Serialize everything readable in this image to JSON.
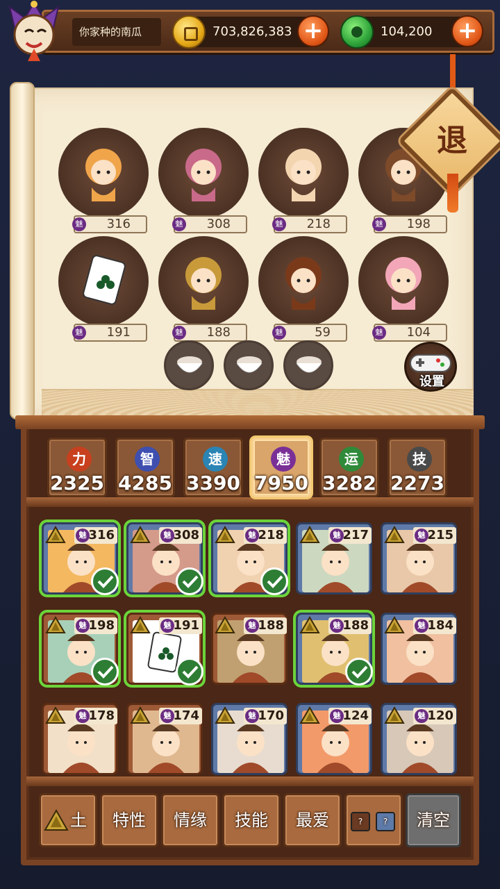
{
  "player": {
    "name": "你家种的南瓜",
    "gold": "703,826,383",
    "jade": "104,200"
  },
  "exit_label": "退",
  "settings_label": "设置",
  "top_heroes": [
    {
      "charm_badge": "魅",
      "charm": "316"
    },
    {
      "charm_badge": "魅",
      "charm": "308"
    },
    {
      "charm_badge": "魅",
      "charm": "218"
    },
    {
      "charm_badge": "魅",
      "charm": "198"
    },
    {
      "charm_badge": "魅",
      "charm": "191"
    },
    {
      "charm_badge": "魅",
      "charm": "188"
    },
    {
      "charm_badge": "魅",
      "charm": "59"
    },
    {
      "charm_badge": "魅",
      "charm": "104"
    }
  ],
  "stats": [
    {
      "label": "力",
      "value": "2325",
      "color": "#c8401e"
    },
    {
      "label": "智",
      "value": "4285",
      "color": "#3e4fb0"
    },
    {
      "label": "速",
      "value": "3390",
      "color": "#2a84b4"
    },
    {
      "label": "魅",
      "value": "7950",
      "color": "#7a2f96"
    },
    {
      "label": "运",
      "value": "3282",
      "color": "#2f8a3a"
    },
    {
      "label": "技",
      "value": "2273",
      "color": "#4a4a4a"
    }
  ],
  "cards": [
    {
      "charm": "316",
      "selected": true
    },
    {
      "charm": "308",
      "selected": true
    },
    {
      "charm": "218",
      "selected": true
    },
    {
      "charm": "217",
      "selected": false
    },
    {
      "charm": "215",
      "selected": false
    },
    {
      "charm": "198",
      "selected": true
    },
    {
      "charm": "191",
      "selected": true
    },
    {
      "charm": "188",
      "selected": false
    },
    {
      "charm": "188",
      "selected": true
    },
    {
      "charm": "184",
      "selected": false
    },
    {
      "charm": "178",
      "selected": false
    },
    {
      "charm": "174",
      "selected": false
    },
    {
      "charm": "170",
      "selected": false
    },
    {
      "charm": "124",
      "selected": false
    },
    {
      "charm": "120",
      "selected": false
    }
  ],
  "filters": {
    "element": "土",
    "trait": "特性",
    "fate": "情缘",
    "skill": "技能",
    "favorite": "最爱",
    "unknown_a": "?",
    "unknown_b": "?",
    "clear": "清空"
  }
}
